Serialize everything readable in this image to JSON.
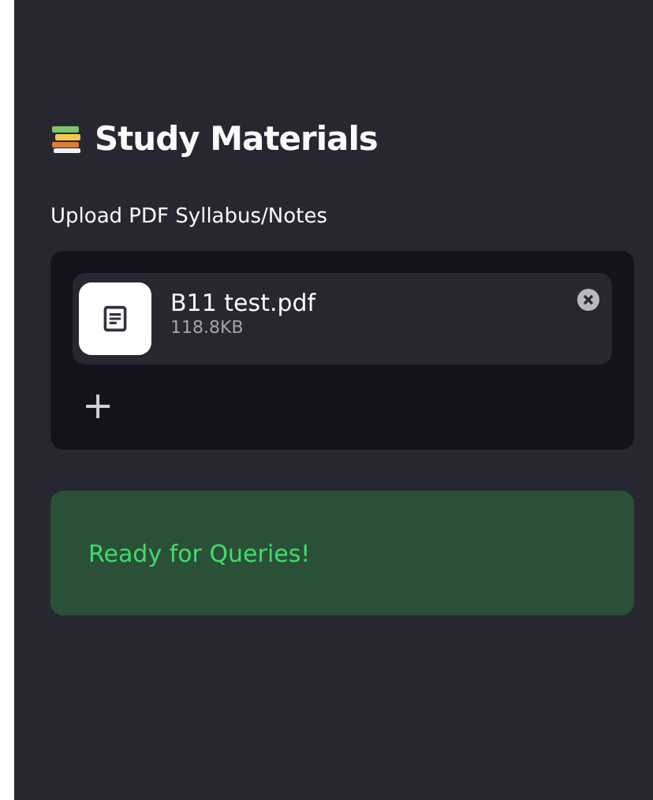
{
  "sidebar": {
    "title": "Study Materials",
    "uploader": {
      "label": "Upload PDF Syllabus/Notes",
      "files": [
        {
          "name": "B11 test.pdf",
          "size": "118.8KB"
        }
      ],
      "add_button": "+"
    },
    "status": {
      "kind": "success",
      "message": "Ready for Queries!"
    }
  }
}
